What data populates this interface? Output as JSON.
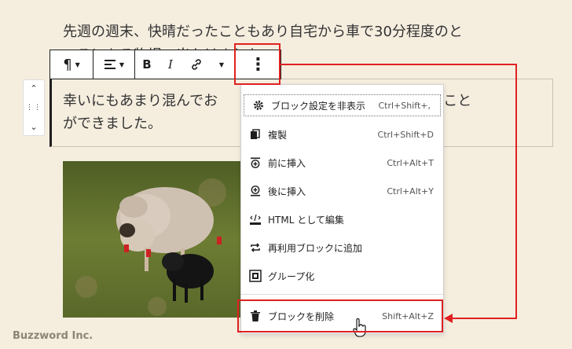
{
  "paragraphs": {
    "p1_line1": "先週の週末、快晴だったこともあり自宅から車で30分程度のと",
    "p1_line2": "ころにある牧場へ出かけました。",
    "p2_line1": "幸いにもあまり混んでお",
    "p2_line1_end": "を過ごすこと",
    "p2_line2": "ができました。"
  },
  "toolbar": {
    "paragraph_glyph": "¶",
    "bold": "B",
    "italic": "I"
  },
  "menu": {
    "items": [
      {
        "label": "ブロック設定を非表示",
        "shortcut": "Ctrl+Shift+,",
        "icon": "gear-icon"
      },
      {
        "label": "複製",
        "shortcut": "Ctrl+Shift+D",
        "icon": "duplicate-icon"
      },
      {
        "label": "前に挿入",
        "shortcut": "Ctrl+Alt+T",
        "icon": "insert-before-icon"
      },
      {
        "label": "後に挿入",
        "shortcut": "Ctrl+Alt+Y",
        "icon": "insert-after-icon"
      },
      {
        "label": "HTML として編集",
        "shortcut": "",
        "icon": "html-icon"
      },
      {
        "label": "再利用ブロックに追加",
        "shortcut": "",
        "icon": "reusable-icon"
      },
      {
        "label": "グループ化",
        "shortcut": "",
        "icon": "group-icon"
      },
      {
        "label": "ブロックを削除",
        "shortcut": "Shift+Alt+Z",
        "icon": "trash-icon"
      }
    ]
  },
  "footer": {
    "brand": "Buzzword Inc."
  },
  "colors": {
    "highlight": "#e02020",
    "background": "#f5eedf"
  }
}
